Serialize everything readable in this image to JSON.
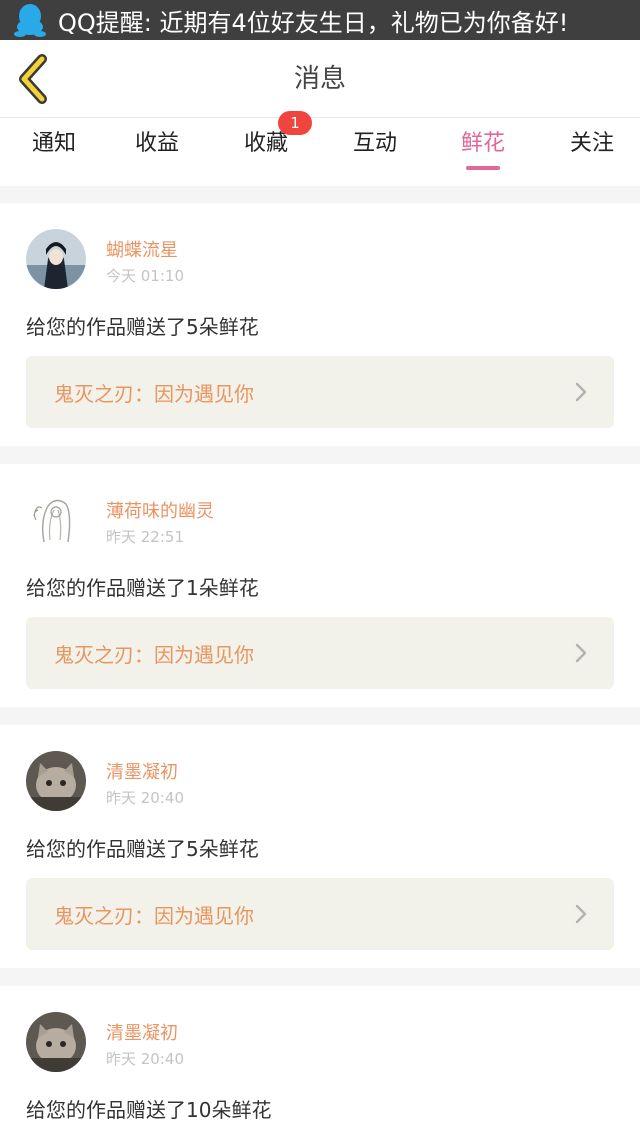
{
  "notification": {
    "icon": "qq-penguin-icon",
    "text": "QQ提醒: 近期有4位好友生日，礼物已为你备好!"
  },
  "header": {
    "back_icon": "back-arrow-icon",
    "title": "消息"
  },
  "tabs": [
    {
      "label": "通知",
      "active": false
    },
    {
      "label": "收益",
      "active": false
    },
    {
      "label": "收藏",
      "active": false,
      "badge": "1"
    },
    {
      "label": "互动",
      "active": false
    },
    {
      "label": "鲜花",
      "active": true
    },
    {
      "label": "关注",
      "active": false
    }
  ],
  "colors": {
    "accent": "#e2669a",
    "name": "#ea9464",
    "badge": "#f0443f",
    "link_bg": "#f3f2ea"
  },
  "messages": [
    {
      "user": "蝴蝶流星",
      "time": "今天 01:10",
      "text": "给您的作品赠送了5朵鲜花",
      "work": "鬼灭之刃：因为遇见你"
    },
    {
      "user": "薄荷味的幽灵",
      "time": "昨天 22:51",
      "text": "给您的作品赠送了1朵鲜花",
      "work": "鬼灭之刃：因为遇见你"
    },
    {
      "user": "清墨凝初",
      "time": "昨天 20:40",
      "text": "给您的作品赠送了5朵鲜花",
      "work": "鬼灭之刃：因为遇见你"
    },
    {
      "user": "清墨凝初",
      "time": "昨天 20:40",
      "text": "给您的作品赠送了10朵鲜花"
    }
  ]
}
